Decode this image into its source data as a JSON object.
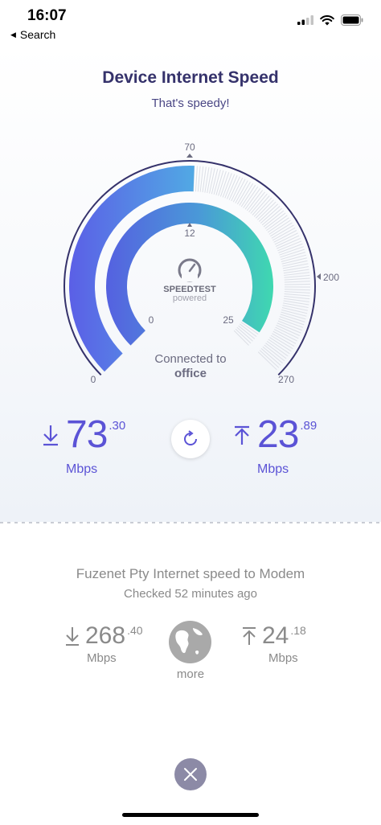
{
  "status": {
    "time": "16:07",
    "back_label": "Search"
  },
  "header": {
    "title": "Device Internet Speed",
    "subtitle": "That's speedy!"
  },
  "gauge": {
    "outer": {
      "min_label": "0",
      "top_label": "70",
      "right_label": "200",
      "max_label": "270",
      "value": 73.3
    },
    "inner": {
      "min_label": "0",
      "top_label": "12",
      "max_label": "25",
      "value": 23.89
    },
    "logo_text": "SPEEDTEST",
    "logo_sub": "powered",
    "connected_label": "Connected to",
    "connected_location": "office"
  },
  "device": {
    "download": {
      "int": "73",
      "dec": ".30",
      "unit": "Mbps"
    },
    "upload": {
      "int": "23",
      "dec": ".89",
      "unit": "Mbps"
    }
  },
  "isp": {
    "name": "Fuzenet Pty Internet speed to Modem",
    "checked": "Checked 52 minutes ago",
    "download": {
      "int": "268",
      "dec": ".40",
      "unit": "Mbps"
    },
    "upload": {
      "int": "24",
      "dec": ".18",
      "unit": "Mbps"
    },
    "more_label": "more"
  },
  "colors": {
    "accent": "#5b53d6",
    "outer_start": "#5b62e8",
    "outer_end": "#4faee6",
    "inner_end": "#3dd6b0"
  }
}
